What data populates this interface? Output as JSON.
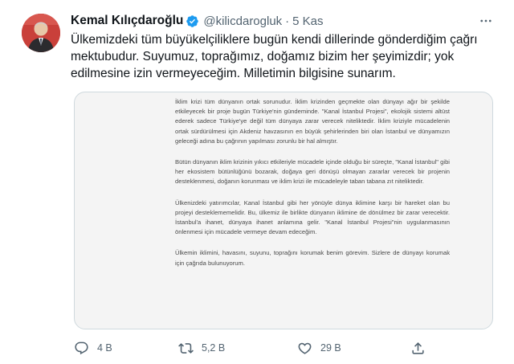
{
  "tweet": {
    "author": {
      "display_name": "Kemal Kılıçdaroğlu",
      "handle": "@kilicdarogluk",
      "separator": "·",
      "date": "5 Kas"
    },
    "text": "Ülkemizdeki tüm büyükelçiliklere bugün kendi dillerinde gönderdiğim çağrı mektubudur. Suyumuz, toprağımız, doğamız bizim her şeyimizdir; yok edilmesine izin vermeyeceğim. Milletimin bilgisine sunarım.",
    "media": {
      "paragraphs": [
        "İklim krizi tüm dünyanın ortak sorunudur. İklim krizinden geçmekte olan dünyayı ağır bir şekilde etkileyecek bir proje bugün Türkiye'nin gündeminde. \"Kanal İstanbul Projesi\", ekolojik sistemi altüst ederek sadece Türkiye'ye değil tüm dünyaya zarar verecek niteliktedir. İklim kriziyle mücadelenin ortak sürdürülmesi için Akdeniz havzasının en büyük şehirlerinden biri olan İstanbul ve dünyamızın geleceği adına bu çağrının yapılması zorunlu bir hal almıştır.",
        "Bütün dünyanın iklim krizinin yıkıcı etkileriyle mücadele içinde olduğu bir süreçte, \"Kanal İstanbul\" gibi her ekosistem bütünlüğünü bozarak, doğaya geri dönüşü olmayan zararlar verecek bir projenin desteklenmesi, doğanın korunması ve iklim krizi ile mücadeleyle taban tabana zıt niteliktedir.",
        "Ülkenizdeki yatırımcılar, Kanal İstanbul gibi her yönüyle dünya iklimine karşı bir hareket olan bu projeyi desteklememelidir. Bu, ülkemiz ile birlikte dünyanın iklimine de dönülmez bir zarar verecektir. İstanbul'a ihanet, dünyaya ihanet anlamına gelir. \"Kanal İstanbul Projesi\"nin uygulanmasının önlenmesi için mücadele vermeye devam edeceğim.",
        "Ülkemin iklimini, havasını, suyunu, toprağını korumak benim görevim. Sizlere de dünyayı korumak için çağrıda bulunuyorum."
      ]
    },
    "stats": {
      "replies": "4 B",
      "retweets": "5,2 B",
      "likes": "29 B"
    }
  },
  "icons": {
    "verified": "verified-badge-icon",
    "more": "more-icon",
    "reply": "reply-icon",
    "retweet": "retweet-icon",
    "like": "heart-icon",
    "share": "share-icon"
  },
  "colors": {
    "verified_blue": "#1d9bf0",
    "secondary_text": "#536471",
    "avatar_red": "#c43a35"
  }
}
